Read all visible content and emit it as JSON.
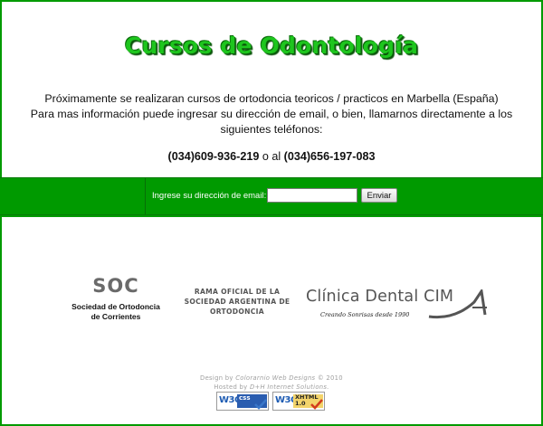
{
  "header": {
    "title": "Cursos de Odontología",
    "intro_line1": "Próximamente se realizaran cursos de ortodoncia teoricos / practicos en Marbella (España)",
    "intro_line2": "Para mas información puede ingresar su dirección de email, o bien, llamarnos directamente a los",
    "intro_line3": "siguientes teléfonos:",
    "phone1": "(034)609-936-219",
    "phone_joiner": "o al",
    "phone2": "(034)656-197-083"
  },
  "form": {
    "email_label": "Ingrese su dirección de email:",
    "email_value": "",
    "submit_label": "Enviar"
  },
  "logos": {
    "soc": {
      "mark": "SOC",
      "line1": "Sociedad de Ortodoncia",
      "line2": "de Corrientes"
    },
    "rama": {
      "line1": "RAMA OFICIAL DE LA",
      "line2": "SOCIEDAD ARGENTINA DE",
      "line3": "ORTODONCIA"
    },
    "cim": {
      "name": "Clínica Dental CIM",
      "tagline": "Creando Sonrisas desde 1990"
    }
  },
  "footer": {
    "design_prefix": "Design by",
    "design_brand": "Colorarnio Web Designs",
    "design_suffix": "© 2010",
    "hosted_prefix": "Hosted by",
    "hosted_brand": "D+H Internet Solutions."
  },
  "badges": {
    "css": {
      "w3c": "W3C",
      "label": "css"
    },
    "xhtml": {
      "w3c": "W3C",
      "label": "XHTML",
      "version": "1.0"
    }
  },
  "colors": {
    "page_green": "#009a00",
    "title_green": "#1ec51e",
    "panel_white": "#ffffff"
  }
}
